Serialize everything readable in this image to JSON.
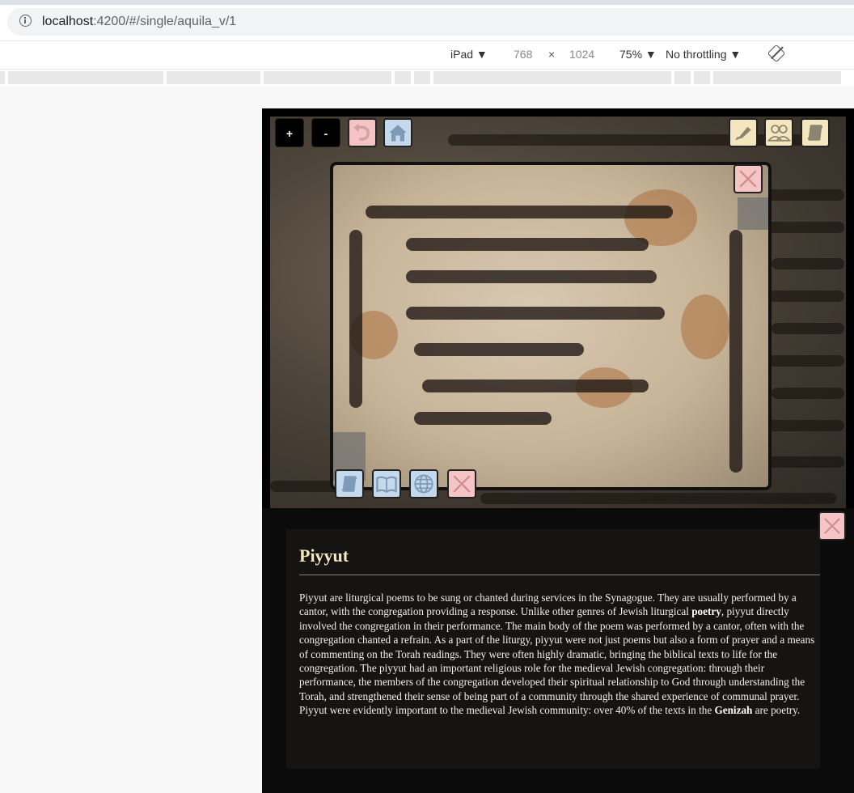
{
  "browser": {
    "url_host": "localhost",
    "url_path": ":4200/#/single/aquila_v/1"
  },
  "devtools": {
    "device": "iPad ▼",
    "width": "768",
    "times": "×",
    "height": "1024",
    "zoom": "75% ▼",
    "throttling": "No throttling ▼"
  },
  "viewer": {
    "zoom_in": "+",
    "zoom_out": "-"
  },
  "info": {
    "title": "Piyyut",
    "text_1": "Piyyut are liturgical poems to be sung or chanted during services in the Synagogue. They are usually performed by a cantor, with the congregation providing a response. Unlike other genres of Jewish liturgical ",
    "bold_1": "poetry",
    "text_2": ", piyyut directly involved the congregation in their performance. The main body of the poem was performed by a cantor, often with the congregation chanted a refrain. As a part of the liturgy, piyyut were not just poems but also a form of prayer and a means of commenting on the Torah readings. They were often highly dramatic, bringing the biblical texts to life for the congregation. The piyyut had an important religious role for the medieval Jewish congregation: through their performance, the members of the congregation developed their spiritual relationship to God through understanding the Torah, and strengthened their sense of being part of a community through the shared experience of communal prayer. Piyyut were evidently important to the medieval Jewish community: over 40% of the texts in the ",
    "bold_2": "Genizah",
    "text_3": " are poetry."
  },
  "colors": {
    "pink_button": "#f5c4c4",
    "blue_button": "#c5d9ec",
    "cream_button": "#f4e7bf",
    "title_color": "#f4e7bf"
  }
}
